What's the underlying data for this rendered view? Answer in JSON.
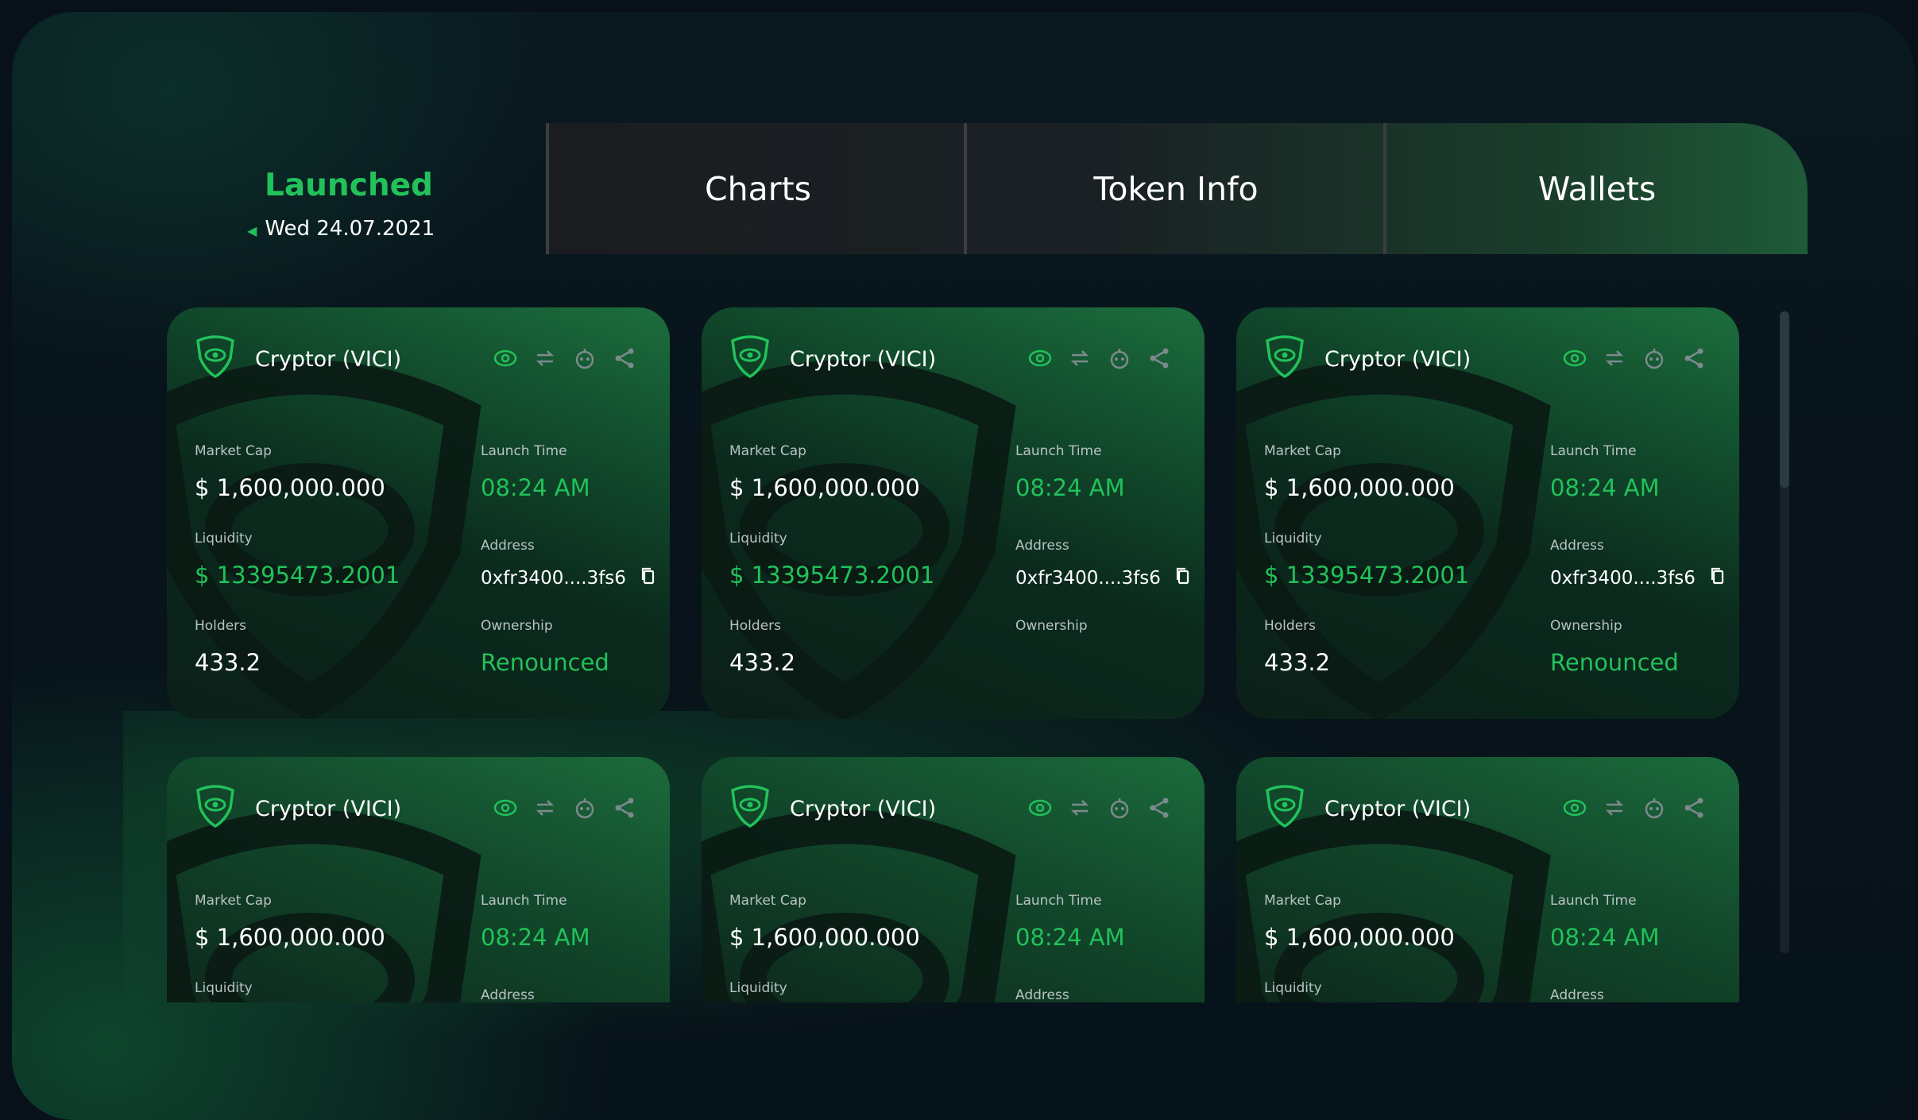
{
  "header": {
    "status_title": "Launched",
    "status_date": "Wed 24.07.2021",
    "tabs": [
      {
        "label": "Charts"
      },
      {
        "label": "Token Info"
      },
      {
        "label": "Wallets"
      }
    ]
  },
  "labels": {
    "market_cap": "Market Cap",
    "launch_time": "Launch Time",
    "liquidity": "Liquidity",
    "address": "Address",
    "holders": "Holders",
    "ownership": "Ownership"
  },
  "cards": [
    {
      "name": "Cryptor (VICI)",
      "market_cap": "$ 1,600,000.000",
      "launch_time": "08:24 AM",
      "liquidity": "$ 13395473.2001",
      "address": "0xfr3400....3fs6",
      "holders": "433.2",
      "ownership": "Renounced"
    },
    {
      "name": "Cryptor (VICI)",
      "market_cap": "$ 1,600,000.000",
      "launch_time": "08:24 AM",
      "liquidity": "$ 13395473.2001",
      "address": "0xfr3400....3fs6",
      "holders": "433.2",
      "ownership": ""
    },
    {
      "name": "Cryptor (VICI)",
      "market_cap": "$ 1,600,000.000",
      "launch_time": "08:24 AM",
      "liquidity": "$ 13395473.2001",
      "address": "0xfr3400....3fs6",
      "holders": "433.2",
      "ownership": "Renounced"
    },
    {
      "name": "Cryptor (VICI)",
      "market_cap": "$ 1,600,000.000",
      "launch_time": "08:24 AM"
    },
    {
      "name": "Cryptor (VICI)",
      "market_cap": "$ 1,600,000.000",
      "launch_time": "08:24 AM"
    },
    {
      "name": "Cryptor (VICI)",
      "market_cap": "$ 1,600,000.000",
      "launch_time": "08:24 AM"
    }
  ],
  "icons": [
    "eye-icon",
    "swap-icon",
    "robot-icon",
    "share-icon",
    "copy-icon",
    "shield-logo-icon"
  ],
  "colors": {
    "accent": "#21c25a",
    "background": "#08111a"
  }
}
